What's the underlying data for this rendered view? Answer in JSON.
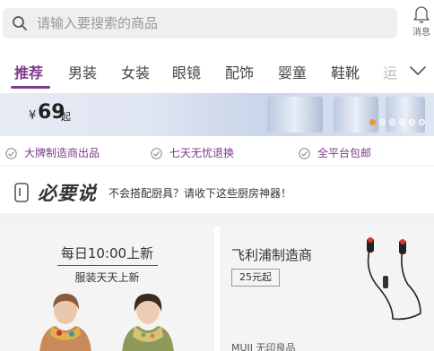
{
  "search": {
    "placeholder": "请输入要搜索的商品"
  },
  "header": {
    "message_label": "消息"
  },
  "tabs": [
    {
      "label": "推荐",
      "active": true
    },
    {
      "label": "男装"
    },
    {
      "label": "女装"
    },
    {
      "label": "眼镜"
    },
    {
      "label": "配饰"
    },
    {
      "label": "婴童"
    },
    {
      "label": "鞋靴"
    },
    {
      "label": "运"
    }
  ],
  "banner": {
    "currency": "¥",
    "price": "69",
    "unit": "起",
    "carousel_count": 6,
    "carousel_active": 0
  },
  "guarantees": [
    {
      "label": "大牌制造商出品"
    },
    {
      "label": "七天无忧退换"
    },
    {
      "label": "全平台包邮"
    }
  ],
  "must_say": {
    "title": "必要说",
    "text": "不会搭配厨具？请收下这些厨房神器！"
  },
  "cards": {
    "left": {
      "title": "每日10:00上新",
      "subtitle": "服装天天上新"
    },
    "right": {
      "title": "飞利浦制造商",
      "price": "25元起",
      "footer": "MUJI 无印良品"
    }
  },
  "colors": {
    "accent": "#7c3a8a",
    "carousel_active": "#e39b2e"
  }
}
